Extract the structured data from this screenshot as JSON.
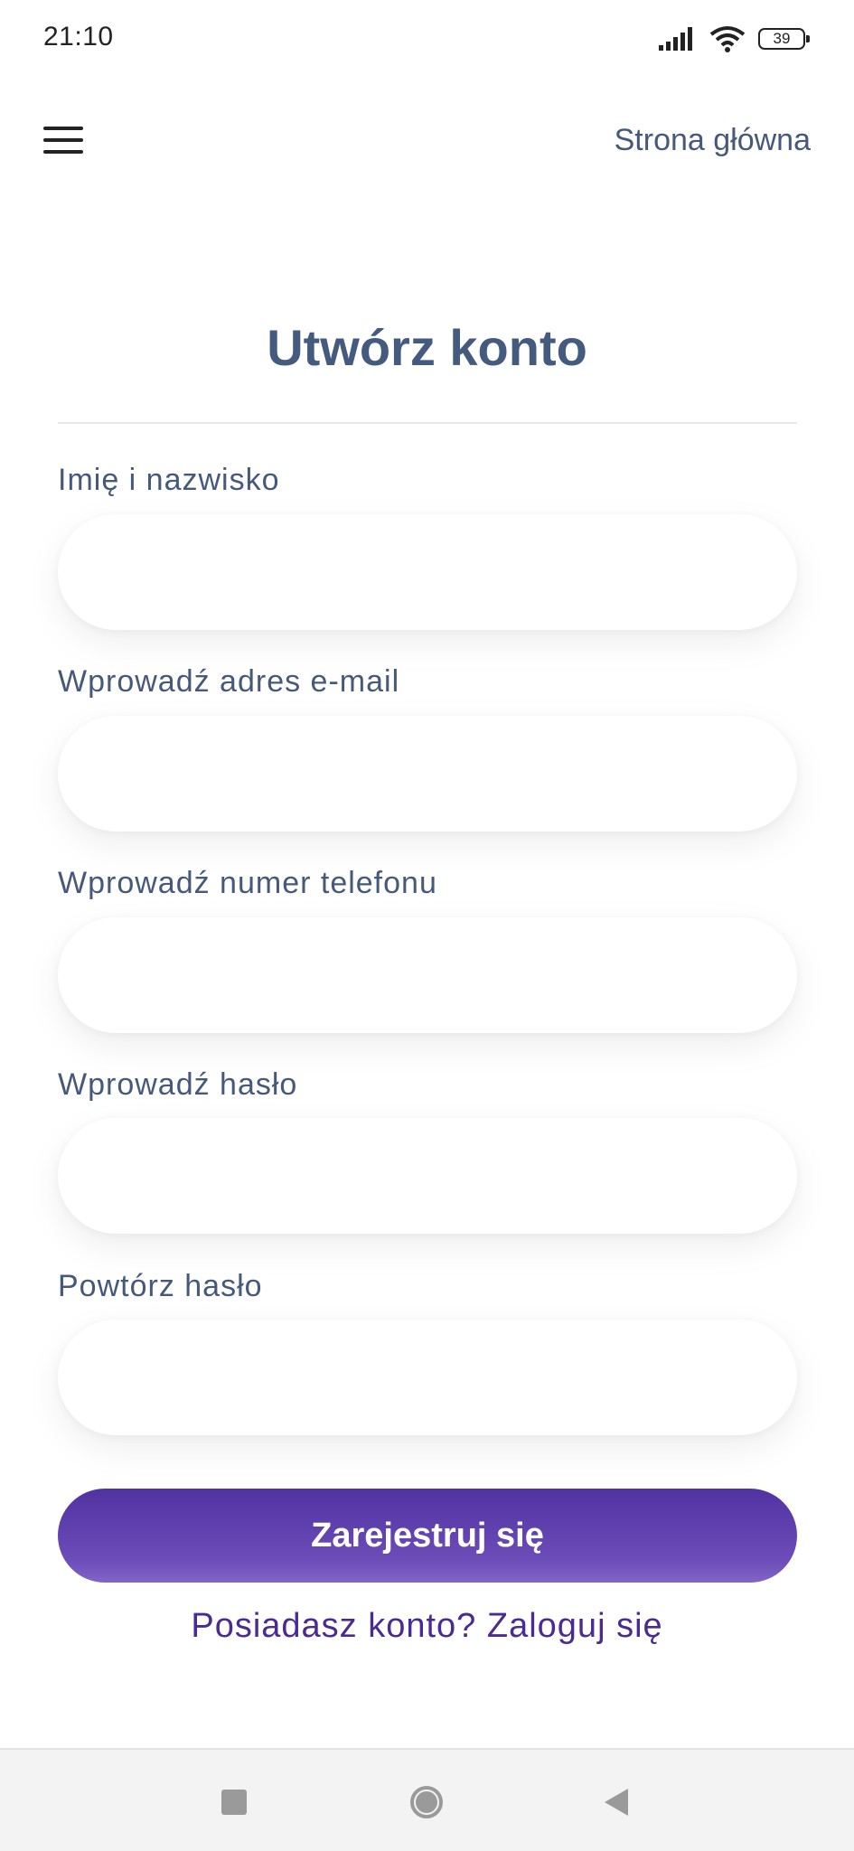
{
  "status_bar": {
    "time": "21:10",
    "battery": "39",
    "icons": [
      "signal-icon",
      "wifi-icon",
      "battery-icon"
    ]
  },
  "header": {
    "menu_icon": "hamburger-menu-icon",
    "home_link": "Strona główna"
  },
  "form": {
    "title": "Utwórz konto",
    "fields": [
      {
        "label": "Imię i nazwisko",
        "value": "",
        "placeholder": ""
      },
      {
        "label": "Wprowadź adres e-mail",
        "value": "",
        "placeholder": ""
      },
      {
        "label": "Wprowadź numer telefonu",
        "value": "",
        "placeholder": ""
      },
      {
        "label": "Wprowadź hasło",
        "value": "",
        "placeholder": ""
      },
      {
        "label": "Powtórz hasło",
        "value": "",
        "placeholder": ""
      }
    ],
    "submit_label": "Zarejestruj się",
    "login_link": "Posiadasz konto? Zaloguj się"
  },
  "colors": {
    "text": "#46597a",
    "button_top": "#5132a1",
    "button_bottom": "#8065c6",
    "link": "#4a2a93"
  },
  "nav_bar": {
    "icons": [
      "recent-apps-icon",
      "home-icon",
      "back-icon"
    ]
  }
}
